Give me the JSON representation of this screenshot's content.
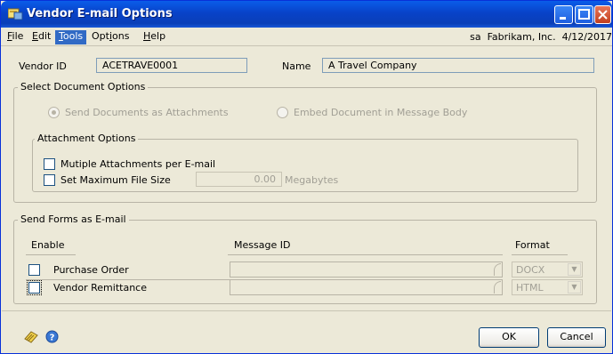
{
  "window": {
    "title": "Vendor E-mail Options"
  },
  "menu": {
    "items": [
      {
        "label": "File",
        "u": "F",
        "rest": "ile"
      },
      {
        "label": "Edit",
        "u": "E",
        "rest": "dit"
      },
      {
        "label": "Tools",
        "u": "T",
        "rest": "ools"
      },
      {
        "label": "Options",
        "pre": "Opt",
        "u": "i",
        "rest": "ons"
      },
      {
        "label": "Help",
        "u": "H",
        "rest": "elp"
      }
    ],
    "status": "sa  Fabrikam, Inc.  4/12/2017"
  },
  "vendor": {
    "id_label": "Vendor ID",
    "id_value": "ACETRAVE0001",
    "name_label": "Name",
    "name_value": "A Travel Company"
  },
  "select_document": {
    "title": "Select Document Options",
    "option_attachments": "Send Documents as Attachments",
    "option_embed": "Embed Document in Message Body",
    "attachment_options": {
      "title": "Attachment Options",
      "multiple_label": "Mutiple Attachments per E-mail",
      "max_size_label": "Set Maximum File Size",
      "max_size_value": "0.00",
      "unit": "Megabytes"
    }
  },
  "send_forms": {
    "title": "Send Forms as E-mail",
    "col_enable": "Enable",
    "col_message_id": "Message ID",
    "col_format": "Format",
    "rows": [
      {
        "label": "Purchase Order",
        "format": "DOCX"
      },
      {
        "label": "Vendor Remittance",
        "format": "HTML"
      }
    ]
  },
  "buttons": {
    "ok": "OK",
    "cancel": "Cancel"
  },
  "colors": {
    "titlebar": "#0a4fd8",
    "dialog_bg": "#ece9d8",
    "menu_highlight": "#316ac5"
  }
}
